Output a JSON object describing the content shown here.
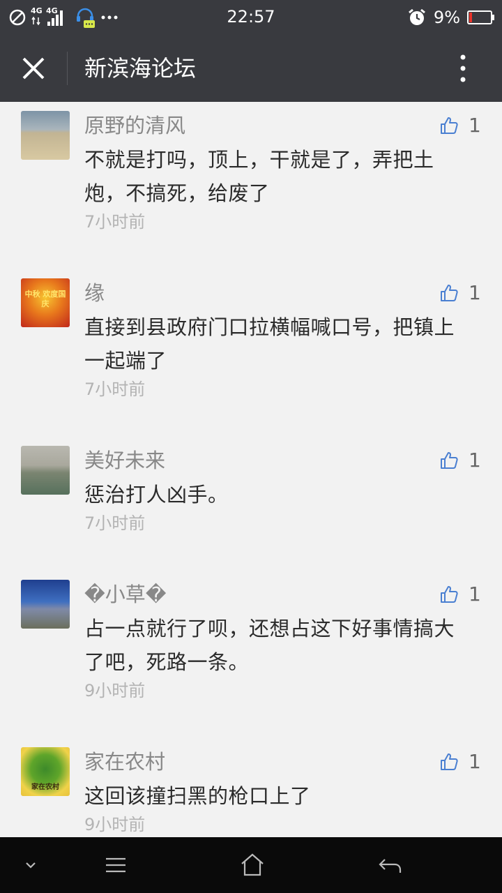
{
  "status_bar": {
    "network_labels": [
      "4G",
      "4G"
    ],
    "time": "22:57",
    "battery_percent": "9%",
    "icons": [
      "no-disturb-icon",
      "signal-icon",
      "chat-notification-icon",
      "more-dots-icon",
      "alarm-icon",
      "battery-icon"
    ]
  },
  "header": {
    "title": "新滨海论坛",
    "close_icon": "close-icon",
    "more_icon": "more-vertical-icon"
  },
  "comments": [
    {
      "author": "原野的清风",
      "likes": "1",
      "text": "不就是打吗，顶上，干就是了，弄把土炮，不搞死，给废了",
      "time": "7小时前"
    },
    {
      "author": "缘",
      "likes": "1",
      "text": "直接到县政府门口拉横幅喊口号，把镇上一起端了",
      "time": "7小时前",
      "avatar_text": "中秋 欢度国庆"
    },
    {
      "author": "美好未来",
      "likes": "1",
      "text": "惩治打人凶手。",
      "time": "7小时前"
    },
    {
      "author": "�小草�",
      "likes": "1",
      "text": "占一点就行了呗，还想占这下好事情搞大了吧，死路一条。",
      "time": "9小时前"
    },
    {
      "author": "家在农村",
      "likes": "1",
      "text": "这回该撞扫黑的枪口上了",
      "time": "9小时前",
      "avatar_text": "家在农村"
    }
  ],
  "nav_bar": {
    "icons": [
      "chevron-down-icon",
      "menu-icon",
      "home-icon",
      "back-icon"
    ]
  },
  "colors": {
    "header_bg": "#393a3f",
    "content_bg": "#f2f2f2",
    "like_icon": "#4a7fd1",
    "navbar_bg": "#0a0a0a"
  }
}
